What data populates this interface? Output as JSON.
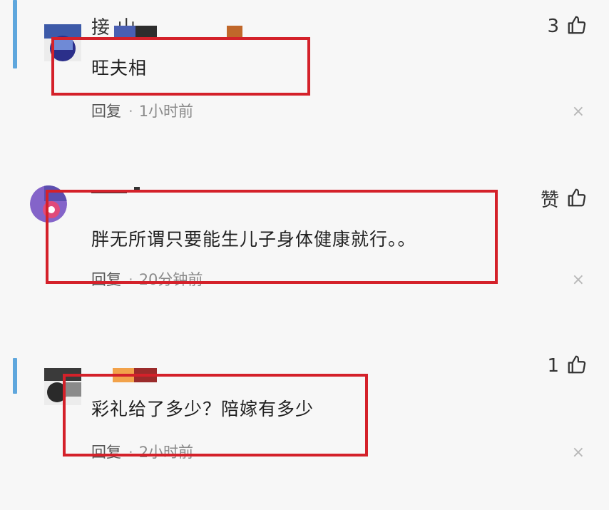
{
  "comments": [
    {
      "username": "接   山",
      "text": "旺夫相",
      "reply_label": "回复",
      "time": "1小时前",
      "like_label": "3",
      "close_glyph": "×"
    },
    {
      "username": "",
      "text": "胖无所谓只要能生儿子身体健康就行。。",
      "reply_label": "回复",
      "time": "20分钟前",
      "like_label": "赞",
      "close_glyph": "×"
    },
    {
      "username": "",
      "text": "彩礼给了多少？陪嫁有多少",
      "reply_label": "回复",
      "time": "2小时前",
      "like_label": "1",
      "close_glyph": "×"
    }
  ],
  "colors": {
    "highlight_border": "#d4212a",
    "accent_bar": "#5fa7dd",
    "background": "#f7f7f7"
  },
  "icons": [
    "thumbs-up-icon",
    "close-icon"
  ]
}
